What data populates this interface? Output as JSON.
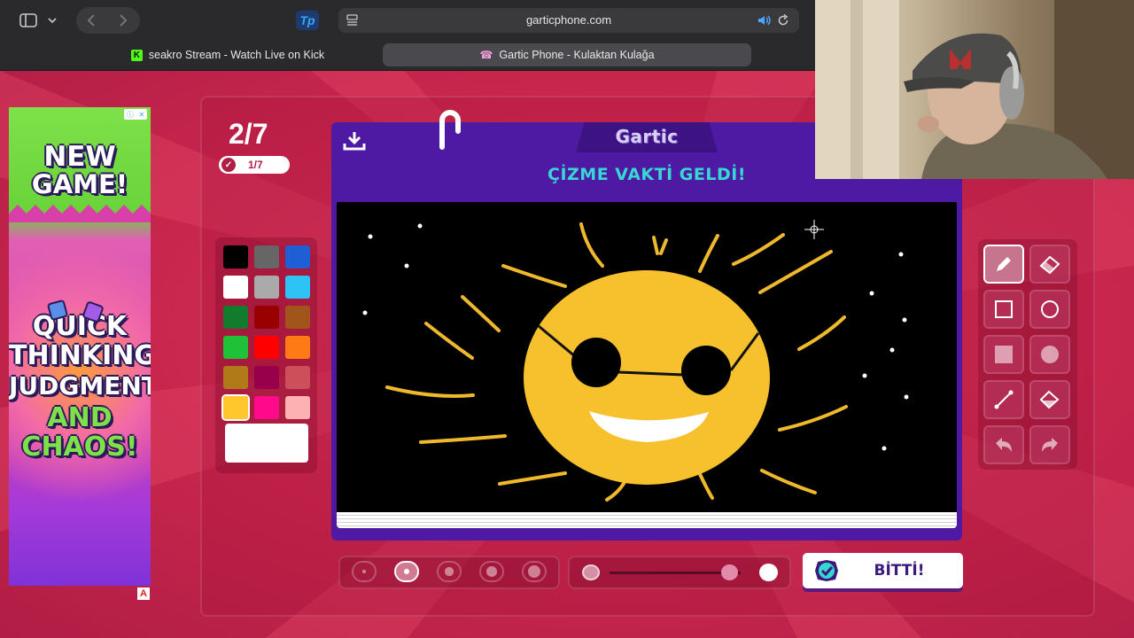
{
  "browser": {
    "url": "garticphone.com",
    "tabs": [
      {
        "label": "seakro Stream - Watch Live on Kick",
        "favicon": "kick-icon"
      },
      {
        "label": "Gartic Phone - Kulaktan Kulağa",
        "favicon": "phone-icon"
      }
    ],
    "extension_badge": "Tp"
  },
  "game": {
    "round": "2/7",
    "done_count": "1/7",
    "logo": "Gartic",
    "prompt": "ÇİZME VAKTİ GELDİ!",
    "done_label": "BİTTİ!",
    "palette": {
      "colors": [
        "#000000",
        "#666666",
        "#1f5fd6",
        "#ffffff",
        "#aaaaaa",
        "#2dc3f5",
        "#137b2c",
        "#990000",
        "#a0561a",
        "#1fc138",
        "#ff0000",
        "#ff7a14",
        "#b07a18",
        "#99004c",
        "#cc4f5a",
        "#ffc72c",
        "#ff0a8a",
        "#fdb1b0"
      ],
      "selected_index": 15,
      "custom_color": "#ffffff"
    },
    "tools": [
      "pencil-icon",
      "eraser-icon",
      "rectangle-outline-icon",
      "circle-outline-icon",
      "rectangle-filled-icon",
      "circle-filled-icon",
      "line-icon",
      "fill-bucket-icon",
      "undo-icon",
      "redo-icon"
    ],
    "active_tool": "pencil-icon",
    "brush_sizes": [
      1,
      2,
      3,
      4,
      5
    ],
    "selected_brush_size_index": 1,
    "opacity_fraction": 0.88
  },
  "ad": {
    "lines": [
      "NEW",
      "GAME!",
      "QUICK",
      "THINKING,",
      "JUDGMENT",
      "AND",
      "CHAOS!"
    ],
    "ad_choices_label": "A"
  },
  "colors": {
    "accent_purple": "#4f1aa3",
    "prompt_teal": "#37d7d3",
    "background_red": "#c3264f"
  }
}
